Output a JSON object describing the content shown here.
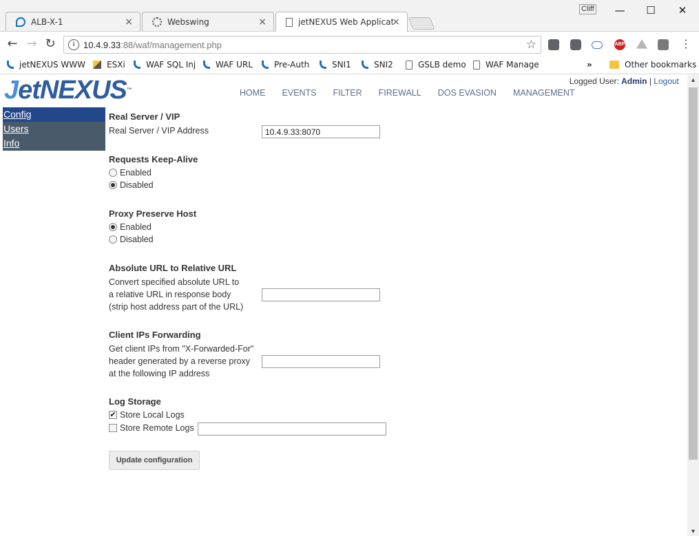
{
  "browser": {
    "window_user": "Cliff",
    "tabs": [
      {
        "label": "ALB-X-1",
        "close": "×"
      },
      {
        "label": "Webswing",
        "close": "×"
      },
      {
        "label": "jetNEXUS Web Applicatio",
        "close": "×"
      }
    ],
    "window_buttons": {
      "minimize": "—",
      "maximize": "☐",
      "close": "✕"
    },
    "nav": {
      "back": "←",
      "forward": "→",
      "reload": "↻"
    },
    "address": {
      "host": "10.4.9.33",
      "rest": ":88/waf/management.php",
      "info_icon": "i",
      "star": "☆"
    },
    "extensions": [
      {
        "name": "pocket-extension-icon",
        "color": "#5f6368",
        "text": ""
      },
      {
        "name": "lastpass-extension-icon",
        "color": "#5f6368",
        "text": ""
      },
      {
        "name": "cloud-extension-icon",
        "color": "#ffffff",
        "text": ""
      },
      {
        "name": "adblock-extension-icon",
        "color": "#d02121",
        "text": "ABP"
      },
      {
        "name": "drive-extension-icon",
        "color": "#b5b5b5",
        "text": ""
      },
      {
        "name": "cast-extension-icon",
        "color": "#7a7a7a",
        "text": ""
      }
    ],
    "menu": "⋮",
    "bookmarks": [
      {
        "label": "jetNEXUS WWW",
        "icon": "jn"
      },
      {
        "label": "ESXi",
        "icon": "esx"
      },
      {
        "label": "WAF SQL Inj",
        "icon": "jn"
      },
      {
        "label": "WAF URL",
        "icon": "jn"
      },
      {
        "label": "Pre-Auth",
        "icon": "jn"
      },
      {
        "label": "SNI1",
        "icon": "jn"
      },
      {
        "label": "SNI2",
        "icon": "jn"
      },
      {
        "label": "GSLB demo",
        "icon": "page"
      },
      {
        "label": "WAF Manage",
        "icon": "page"
      }
    ],
    "bookmarks_overflow": "»",
    "other_bookmarks": "Other bookmarks"
  },
  "site": {
    "logo": {
      "j": "J",
      "rest": "etNEXUS",
      "tm": "™"
    },
    "nav": [
      "HOME",
      "EVENTS",
      "FILTER",
      "FIREWALL",
      "DOS EVASION",
      "MANAGEMENT"
    ],
    "user": {
      "prefix": "Logged User:",
      "name": "Admin",
      "sep": "|",
      "logout": "Logout"
    },
    "sidebar": [
      {
        "label": "Config",
        "active": true
      },
      {
        "label": "Users",
        "active": false
      },
      {
        "label": "Info",
        "active": false
      }
    ]
  },
  "form": {
    "real_server": {
      "title": "Real Server / VIP",
      "label": "Real Server / VIP Address",
      "value": "10.4.9.33:8070"
    },
    "keep_alive": {
      "title": "Requests Keep-Alive",
      "options": [
        {
          "label": "Enabled",
          "checked": false
        },
        {
          "label": "Disabled",
          "checked": true
        }
      ]
    },
    "preserve_host": {
      "title": "Proxy Preserve Host",
      "options": [
        {
          "label": "Enabled",
          "checked": true
        },
        {
          "label": "Disabled",
          "checked": false
        }
      ]
    },
    "abs_url": {
      "title": "Absolute URL to Relative URL",
      "lines": [
        "Convert specified absolute URL to",
        "a relative URL in response body",
        "(strip host address part of the URL)"
      ],
      "value": ""
    },
    "client_ips": {
      "title": "Client IPs Forwarding",
      "lines": [
        "Get client IPs from \"X-Forwarded-For\"",
        "header generated by a reverse proxy",
        "at the following IP address"
      ],
      "value": ""
    },
    "log_storage": {
      "title": "Log Storage",
      "local": {
        "label": "Store Local Logs",
        "checked": true
      },
      "remote": {
        "label": "Store Remote Logs",
        "checked": false,
        "value": ""
      }
    },
    "submit": "Update configuration"
  }
}
